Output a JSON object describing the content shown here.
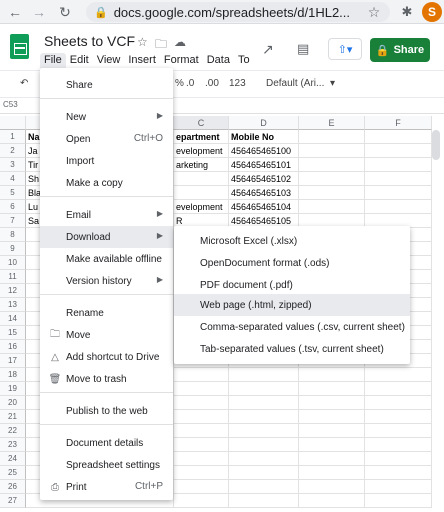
{
  "browser": {
    "url": "docs.google.com/spreadsheets/d/1HL2...",
    "profile_initial": "S"
  },
  "header": {
    "title": "Sheets to VCF",
    "share_label": "Share"
  },
  "menubar": [
    "File",
    "Edit",
    "View",
    "Insert",
    "Format",
    "Data",
    "To"
  ],
  "toolbar": {
    "percent": "%",
    "decimal_less": ".0",
    "decimal_more": ".00",
    "number_format": "123",
    "font": "Default (Ari..."
  },
  "namebox": "C53",
  "grid": {
    "columns": [
      "C",
      "D",
      "E",
      "F"
    ],
    "rows": [
      "1",
      "2",
      "3",
      "4",
      "5",
      "6",
      "7",
      "8",
      "9",
      "10",
      "11",
      "12",
      "13",
      "14",
      "15",
      "16",
      "17",
      "18",
      "19",
      "20",
      "21",
      "22",
      "23",
      "24",
      "25",
      "26",
      "27"
    ],
    "col_a_partial": [
      "Na",
      "Ja",
      "Tir",
      "Sh",
      "Bla",
      "Lu",
      "Sa"
    ],
    "col_c": [
      "epartment",
      "evelopment",
      "arketing",
      "",
      "",
      "evelopment",
      "R"
    ],
    "col_d": [
      "Mobile No",
      "456465465100",
      "456465465101",
      "456465465102",
      "456465465103",
      "456465465104",
      "456465465105"
    ]
  },
  "file_menu": {
    "items": [
      {
        "label": "Share",
        "icon": "",
        "shortcut": "",
        "arrow": false
      },
      {
        "label": "New",
        "icon": "",
        "shortcut": "",
        "arrow": true
      },
      {
        "label": "Open",
        "icon": "",
        "shortcut": "Ctrl+O",
        "arrow": false
      },
      {
        "label": "Import",
        "icon": "",
        "shortcut": "",
        "arrow": false
      },
      {
        "label": "Make a copy",
        "icon": "",
        "shortcut": "",
        "arrow": false
      },
      {
        "label": "Email",
        "icon": "",
        "shortcut": "",
        "arrow": true
      },
      {
        "label": "Download",
        "icon": "",
        "shortcut": "",
        "arrow": true
      },
      {
        "label": "Make available offline",
        "icon": "",
        "shortcut": "",
        "arrow": false
      },
      {
        "label": "Version history",
        "icon": "",
        "shortcut": "",
        "arrow": true
      },
      {
        "label": "Rename",
        "icon": "",
        "shortcut": "",
        "arrow": false
      },
      {
        "label": "Move",
        "icon": "folder-icon",
        "shortcut": "",
        "arrow": false
      },
      {
        "label": "Add shortcut to Drive",
        "icon": "drive-shortcut-icon",
        "shortcut": "",
        "arrow": false
      },
      {
        "label": "Move to trash",
        "icon": "trash-icon",
        "shortcut": "",
        "arrow": false
      },
      {
        "label": "Publish to the web",
        "icon": "",
        "shortcut": "",
        "arrow": false
      },
      {
        "label": "Document details",
        "icon": "",
        "shortcut": "",
        "arrow": false
      },
      {
        "label": "Spreadsheet settings",
        "icon": "",
        "shortcut": "",
        "arrow": false
      },
      {
        "label": "Print",
        "icon": "print-icon",
        "shortcut": "Ctrl+P",
        "arrow": false
      }
    ]
  },
  "download_menu": {
    "items": [
      "Microsoft Excel (.xlsx)",
      "OpenDocument format (.ods)",
      "PDF document (.pdf)",
      "Web page (.html, zipped)",
      "Comma-separated values (.csv, current sheet)",
      "Tab-separated values (.tsv, current sheet)"
    ]
  },
  "colors": {
    "share_green": "#188038",
    "sheets_green": "#0f9d58",
    "hover": "#e8eaed",
    "avatar": "#e37400"
  }
}
